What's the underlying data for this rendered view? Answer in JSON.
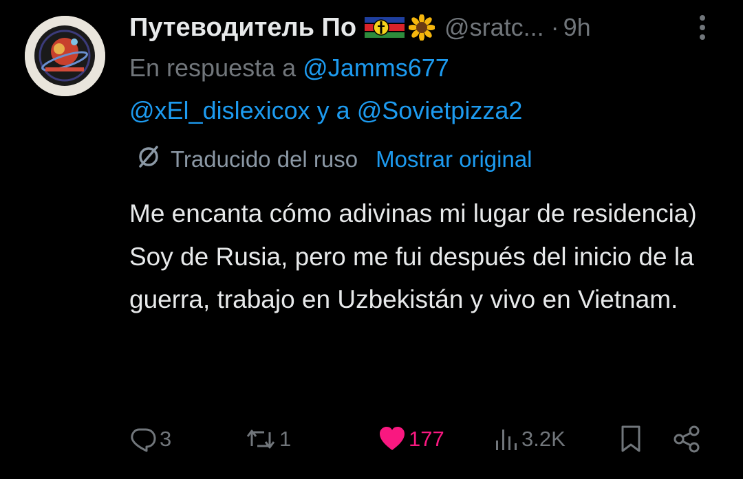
{
  "tweet": {
    "display_name": "Путеводитель По",
    "handle": "@sratc...",
    "separator": "·",
    "time": "9h",
    "avatar_icon": "round-patch-avatar",
    "reply": {
      "prefix": "En respuesta a",
      "mention1": "@Jamms677",
      "mention2": "@xEl_dislexicox",
      "conjunction": "y a",
      "mention3": "@Sovietpizza2"
    },
    "translation": {
      "label": "Traducido del ruso",
      "show_original": "Mostrar original"
    },
    "text": {
      "p1": "Me encanta cómo adivinas mi lugar de residencia)",
      "p2": "Soy de Rusia, pero me fui después del inicio de la guerra, trabajo en Uzbekistán y vivo en Vietnam."
    },
    "actions": {
      "replies": "3",
      "reposts": "1",
      "likes": "177",
      "views": "3.2K"
    }
  },
  "colors": {
    "background": "#000000",
    "text": "#e7e9ea",
    "muted": "#71767b",
    "link": "#1d9bf0",
    "like": "#f91880"
  }
}
